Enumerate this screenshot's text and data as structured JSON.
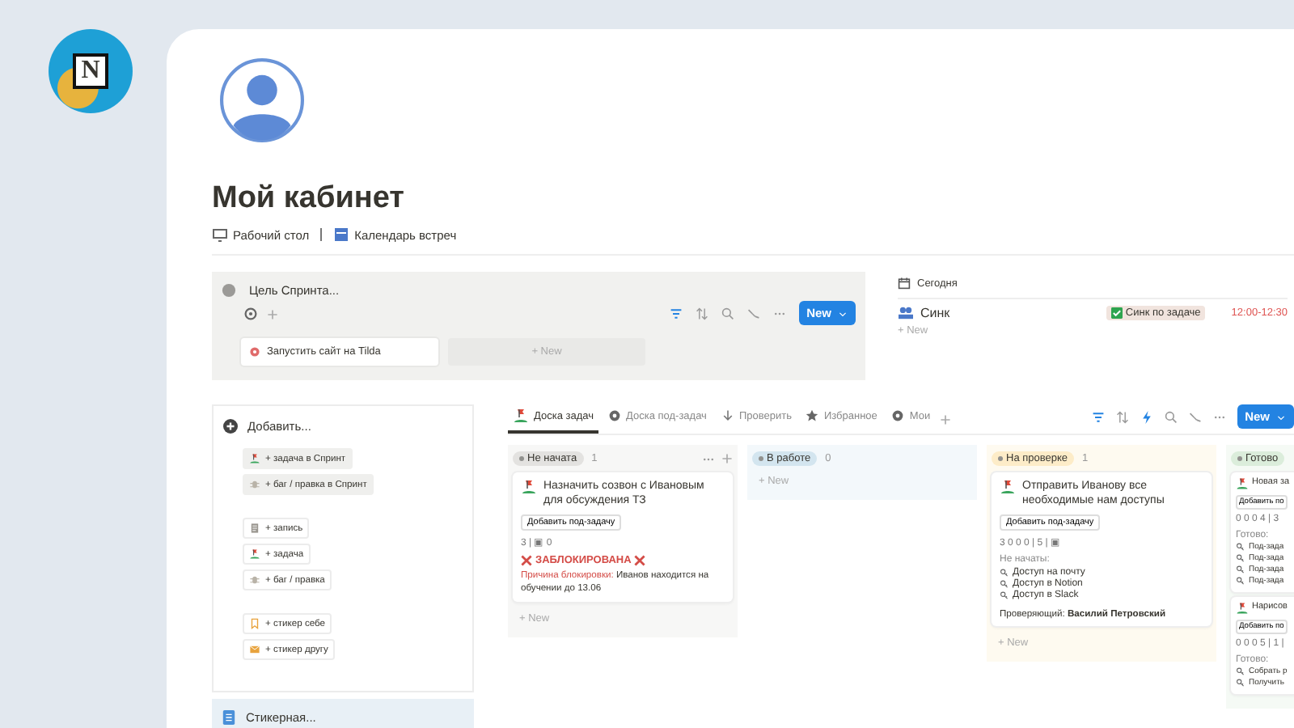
{
  "app_logo": {
    "letter": "N"
  },
  "page": {
    "title": "Мой кабинет",
    "links": [
      {
        "label": "Рабочий стол",
        "kind": "desk"
      },
      {
        "label": "Календарь встреч",
        "kind": "calendar"
      }
    ]
  },
  "sprint_goal": {
    "title": "Цель Спринта...",
    "cards": [
      {
        "title": "Запустить сайт на Tilda"
      }
    ],
    "new_label": "+ New",
    "new_button": "New"
  },
  "today": {
    "title": "Сегодня",
    "events": [
      {
        "name": "Синк",
        "tag": "Синк по задаче",
        "time": "12:00-12:30"
      }
    ],
    "new_label": "+ New"
  },
  "add_panel": {
    "title": "Добавить...",
    "groups": [
      {
        "buttons": [
          {
            "label": "+ задача в Спринт",
            "kind": "task",
            "highlighted": true
          },
          {
            "label": "+ баг / правка в Спринт",
            "kind": "bug",
            "highlighted": true
          }
        ]
      },
      {
        "buttons": [
          {
            "label": "+ запись",
            "kind": "record",
            "highlighted": false
          },
          {
            "label": "+ задача",
            "kind": "task",
            "highlighted": false
          },
          {
            "label": "+ баг / правка",
            "kind": "bug",
            "highlighted": false
          }
        ]
      },
      {
        "buttons": [
          {
            "label": "+ стикер себе",
            "kind": "sticker_self",
            "highlighted": false
          },
          {
            "label": "+ стикер другу",
            "kind": "sticker_friend",
            "highlighted": false
          }
        ]
      }
    ]
  },
  "stickers_panel": {
    "title": "Стикерная..."
  },
  "board": {
    "tabs": [
      {
        "label": "Доска задач",
        "kind": "task",
        "selected": true
      },
      {
        "label": "Доска под-задач",
        "kind": "circle",
        "selected": false
      },
      {
        "label": "Проверить",
        "kind": "arrow",
        "selected": false
      },
      {
        "label": "Избранное",
        "kind": "star",
        "selected": false
      },
      {
        "label": "Мои",
        "kind": "circle",
        "selected": false
      }
    ],
    "new_button": "New",
    "columns": [
      {
        "name": "Не начата",
        "count": "1",
        "color": "#e3e2e0",
        "new_label": "+ New",
        "cards": [
          {
            "title": "Назначить созвон с Ивановым для обсуждения ТЗ",
            "subtask_button": "Добавить под-задачу",
            "counters": "3 | ▣ 0",
            "blocked": {
              "heading": "ЗАБЛОКИРОВАНА",
              "reason_label": "Причина блокировки:",
              "reason": " Иванов находится на обучении до 13.06"
            }
          }
        ]
      },
      {
        "name": "В работе",
        "count": "0",
        "color": "#d3e5ef",
        "new_label": "+ New"
      },
      {
        "name": "На проверке",
        "count": "1",
        "color": "#fdecc8",
        "new_label": "+ New",
        "cards": [
          {
            "title": "Отправить Иванову все необходимые нам доступы",
            "subtask_button": "Добавить под-задачу",
            "counters": "3 0 0 0 | 5 | ▣",
            "list_label": "Не начаты:",
            "items": [
              "Доступ на почту",
              "Доступ в Notion",
              "Доступ в Slack"
            ],
            "reviewer_label": "Проверяющий:",
            "reviewer": "Василий Петровский"
          }
        ]
      },
      {
        "name": "Готово",
        "color": "#dbeddb",
        "cards": [
          {
            "title": "Новая за",
            "subtask_button": "Добавить по",
            "counters": "0 0 0 4 | 3",
            "list_label": "Готово:",
            "items": [
              "Под-зада",
              "Под-зада",
              "Под-зада",
              "Под-зада"
            ]
          },
          {
            "title": "Нарисов",
            "subtask_button": "Добавить по",
            "counters": "0 0 0 5 | 1 |",
            "list_label": "Готово:",
            "items": [
              "Собрать р",
              "Получить"
            ]
          }
        ]
      }
    ]
  }
}
